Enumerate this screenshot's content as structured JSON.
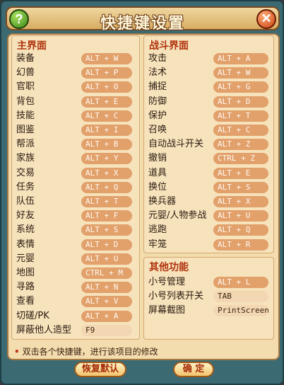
{
  "window": {
    "title": "快捷键设置",
    "help_glyph": "?",
    "close_glyph": "✕"
  },
  "main_section": {
    "title": "主界面",
    "items": [
      {
        "label": "装备",
        "key": "ALT + W"
      },
      {
        "label": "幻兽",
        "key": "ALT + P"
      },
      {
        "label": "官职",
        "key": "ALT + O"
      },
      {
        "label": "背包",
        "key": "ALT + E"
      },
      {
        "label": "技能",
        "key": "ALT + C"
      },
      {
        "label": "图鉴",
        "key": "ALT + I"
      },
      {
        "label": "帮派",
        "key": "ALT + B"
      },
      {
        "label": "家族",
        "key": "ALT + Y"
      },
      {
        "label": "交易",
        "key": "ALT + X"
      },
      {
        "label": "任务",
        "key": "ALT + Q"
      },
      {
        "label": "队伍",
        "key": "ALT + T"
      },
      {
        "label": "好友",
        "key": "ALT + F"
      },
      {
        "label": "系统",
        "key": "ALT + S"
      },
      {
        "label": "表情",
        "key": "ALT + D"
      },
      {
        "label": "元婴",
        "key": "ALT + U"
      },
      {
        "label": "地图",
        "key": "CTRL + M"
      },
      {
        "label": "寻路",
        "key": "ALT + N"
      },
      {
        "label": "查看",
        "key": "ALT + V"
      },
      {
        "label": "切磋/PK",
        "key": "ALT + A"
      },
      {
        "label": "屏蔽他人造型",
        "key": "F9"
      }
    ]
  },
  "battle_section": {
    "title": "战斗界面",
    "items": [
      {
        "label": "攻击",
        "key": "ALT + A"
      },
      {
        "label": "法术",
        "key": "ALT + W"
      },
      {
        "label": "捕捉",
        "key": "ALT + G"
      },
      {
        "label": "防御",
        "key": "ALT + D"
      },
      {
        "label": "保护",
        "key": "ALT + T"
      },
      {
        "label": "召唤",
        "key": "ALT + C"
      },
      {
        "label": "自动战斗开关",
        "key": "ALT + Z"
      },
      {
        "label": "撤销",
        "key": "CTRL + Z"
      },
      {
        "label": "道具",
        "key": "ALT + E"
      },
      {
        "label": "换位",
        "key": "ALT + S"
      },
      {
        "label": "换兵器",
        "key": "ALT + X"
      },
      {
        "label": "元婴/人物参战",
        "key": "ALT + U"
      },
      {
        "label": "逃跑",
        "key": "ALT + Q"
      },
      {
        "label": "牢笼",
        "key": "ALT + R"
      }
    ]
  },
  "other_section": {
    "title": "其他功能",
    "items": [
      {
        "label": "小号管理",
        "key": "ALT + L"
      },
      {
        "label": "小号列表开关",
        "key": "TAB"
      },
      {
        "label": "屏幕截图",
        "key": "PrintScreen"
      }
    ]
  },
  "hint": {
    "bullet": "•",
    "text": "双击各个快捷键，进行该项目的修改"
  },
  "footer": {
    "restore_label": "恢复默认",
    "confirm_label": "确 定"
  }
}
